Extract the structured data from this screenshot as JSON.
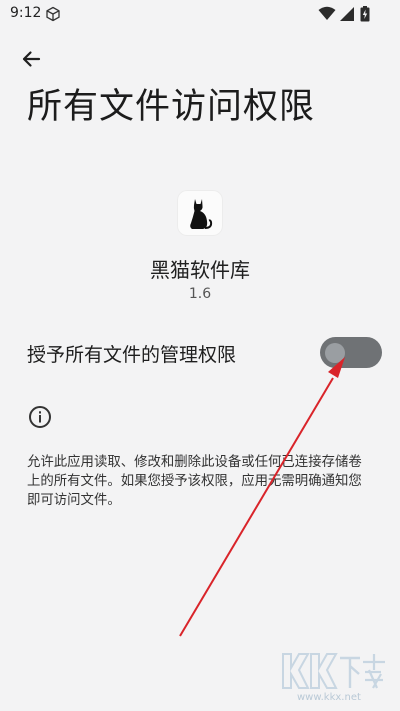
{
  "status_bar": {
    "time": "9:12",
    "icons": [
      "cube-icon",
      "wifi-icon",
      "signal-icon",
      "battery-icon"
    ]
  },
  "header": {
    "back_icon": "arrow-left-icon",
    "title": "所有文件访问权限"
  },
  "app": {
    "name": "黑猫软件库",
    "version": "1.6",
    "icon": "black-cat-icon"
  },
  "permission": {
    "label": "授予所有文件的管理权限",
    "enabled": false
  },
  "info": {
    "icon": "info-icon",
    "description": "允许此应用读取、修改和删除此设备或任何已连接存储卷上的所有文件。如果您授予该权限，应用无需明确通知您即可访问文件。"
  },
  "annotation": {
    "color": "#d9242a"
  },
  "watermark": {
    "logo_text": "KK下载",
    "url": "www.kkx.net"
  },
  "colors": {
    "background": "#f3f3f4",
    "toggle_track": "#6f7275",
    "toggle_knob": "#9a9ea2"
  }
}
